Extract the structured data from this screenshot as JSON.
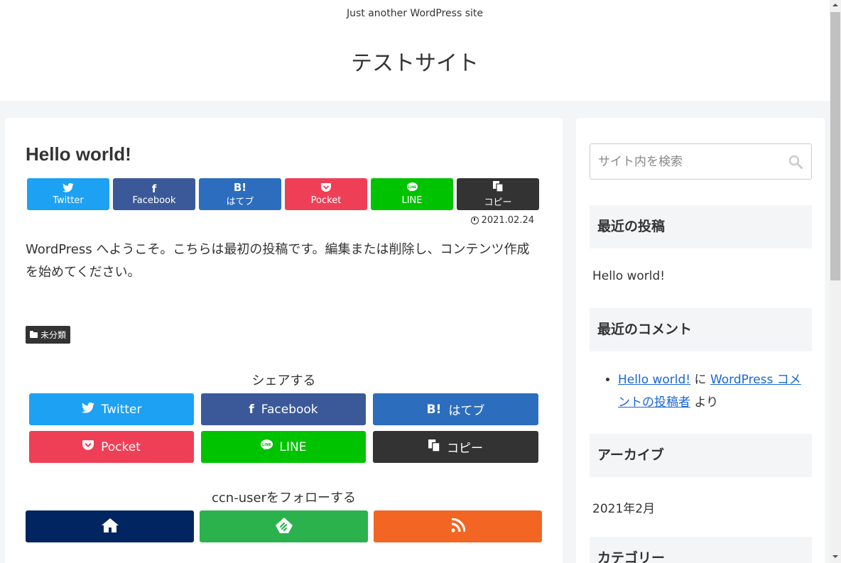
{
  "header": {
    "tagline": "Just another WordPress site",
    "site_title": "テストサイト"
  },
  "post": {
    "title": "Hello world!",
    "date": "2021.02.24",
    "content": "WordPress へようこそ。こちらは最初の投稿です。編集または削除し、コンテンツ作成を始めてください。",
    "category": "未分類"
  },
  "share_top": [
    {
      "label": "Twitter",
      "icon": "twitter-icon",
      "color": "#1da1f2"
    },
    {
      "label": "Facebook",
      "icon": "facebook-icon",
      "color": "#3b5998"
    },
    {
      "label": "はてブ",
      "icon": "hatena-icon",
      "color": "#2c6ebd"
    },
    {
      "label": "Pocket",
      "icon": "pocket-icon",
      "color": "#ef3f56"
    },
    {
      "label": "LINE",
      "icon": "line-icon",
      "color": "#00c300"
    },
    {
      "label": "コピー",
      "icon": "copy-icon",
      "color": "#333333"
    }
  ],
  "share_bottom": {
    "heading": "シェアする",
    "buttons": [
      {
        "label": "Twitter",
        "icon": "twitter-icon",
        "color": "#1da1f2"
      },
      {
        "label": "Facebook",
        "icon": "facebook-icon",
        "color": "#3b5998"
      },
      {
        "label": "はてブ",
        "icon": "hatena-icon",
        "color": "#2c6ebd"
      },
      {
        "label": "Pocket",
        "icon": "pocket-icon",
        "color": "#ef3f56"
      },
      {
        "label": "LINE",
        "icon": "line-icon",
        "color": "#00c300"
      },
      {
        "label": "コピー",
        "icon": "copy-icon",
        "color": "#333333"
      }
    ]
  },
  "follow": {
    "heading": "ccn-userをフォローする",
    "buttons": [
      {
        "icon": "home-icon",
        "color": "#002561"
      },
      {
        "icon": "feedly-icon",
        "color": "#2bb24c"
      },
      {
        "icon": "rss-icon",
        "color": "#f26522"
      }
    ]
  },
  "sidebar": {
    "search_placeholder": "サイト内を検索",
    "recent_posts_title": "最近の投稿",
    "recent_post": "Hello world!",
    "recent_comments_title": "最近のコメント",
    "comment": {
      "post_link": "Hello world!",
      "on": "に",
      "author_link": "WordPress コメントの投稿者",
      "by": "より"
    },
    "archive_title": "アーカイブ",
    "archive_item": "2021年2月",
    "categories_title": "カテゴリー"
  }
}
